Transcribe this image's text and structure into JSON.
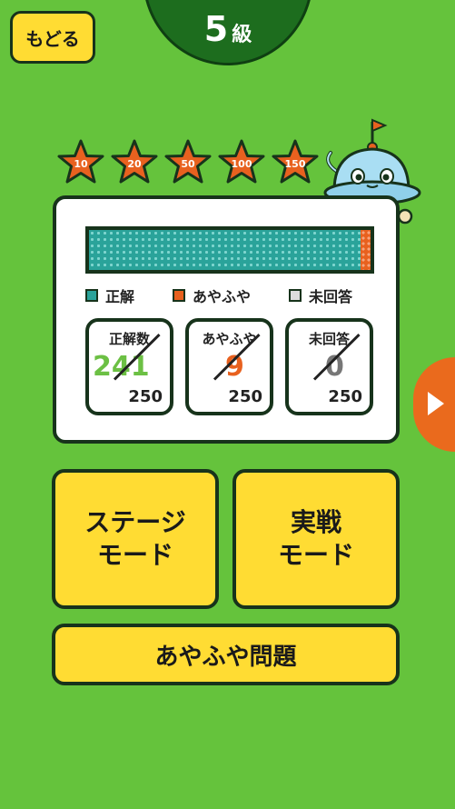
{
  "header": {
    "back_label": "もどる",
    "level_number": "5",
    "level_suffix": "級"
  },
  "milestones": [
    "10",
    "20",
    "50",
    "100",
    "150"
  ],
  "stats": {
    "legend": {
      "correct": "正解",
      "unsure": "あやふや",
      "unanswered": "未回答"
    },
    "correct": {
      "title": "正解数",
      "value": "241",
      "total": "250"
    },
    "unsure": {
      "title": "あやふや",
      "value": "9",
      "total": "250"
    },
    "unanswered": {
      "title": "未回答",
      "value": "0",
      "total": "250"
    }
  },
  "colors": {
    "background": "#65c33c",
    "correct": "#6cc044",
    "unsure": "#e8611f",
    "unanswered": "#777777",
    "button": "#ffdc33"
  },
  "buttons": {
    "stage_line1": "ステージ",
    "stage_line2": "モード",
    "battle_line1": "実戦",
    "battle_line2": "モード",
    "unsure_questions": "あやふや問題"
  },
  "icons": {
    "next": "chevron-right-icon",
    "mascot": "mascot-character"
  }
}
